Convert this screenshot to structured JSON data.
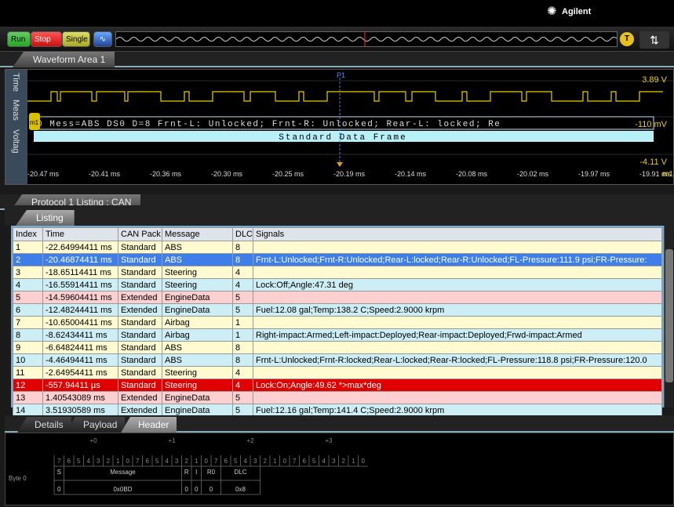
{
  "brand": {
    "name": "Agilent",
    "icon": "agilent-spark-icon"
  },
  "controls": {
    "run": "Run",
    "stop": "Stop",
    "single": "Single",
    "trigger": "T"
  },
  "waveform": {
    "tab": "Waveform Area 1",
    "side_labels": [
      "Time",
      "Meas",
      "Voltag"
    ],
    "ch_top": "3.89 V",
    "ch_mid": "-110 mV",
    "ch_bot": "-4.11 V",
    "marker": "P1",
    "ch_badge": "m1",
    "bottom_unit": "m1",
    "decode_line": "0  Mess=ABS  DS0  D=8  Frnt-L: Unlocked;  Frnt-R: Unlocked;  Rear-L: locked;  Re",
    "frame_label": "Standard Data Frame",
    "time_ticks": [
      "-20.47 ms",
      "-20.41 ms",
      "-20.36 ms",
      "-20.30 ms",
      "-20.25 ms",
      "-20.19 ms",
      "-20.14 ms",
      "-20.08 ms",
      "-20.02 ms",
      "-19.97 ms",
      "-19.91 ms"
    ]
  },
  "protocol": {
    "tab": "Protocol 1 Listing : CAN",
    "listing_tab": "Listing"
  },
  "listing": {
    "headers": [
      "Index",
      "Time",
      "CAN Pack",
      "Message",
      "DLC",
      "Signals"
    ],
    "rows": [
      [
        "1",
        "-22.64994411 ms",
        "Standard",
        "ABS",
        "8",
        ""
      ],
      [
        "2",
        "-20.46874411 ms",
        "Standard",
        "ABS",
        "8",
        "Frnt-L:Unlocked;Frnt-R:Unlocked;Rear-L:locked;Rear-R:Unlocked;FL-Pressure:111.9 psi;FR-Pressure:"
      ],
      [
        "3",
        "-18.65114411 ms",
        "Standard",
        "Steering",
        "4",
        ""
      ],
      [
        "4",
        "-16.55914411 ms",
        "Standard",
        "Steering",
        "4",
        "Lock:Off;Angle:47.31 deg"
      ],
      [
        "5",
        "-14.59604411 ms",
        "Extended",
        "EngineData",
        "5",
        ""
      ],
      [
        "6",
        "-12.48244411 ms",
        "Extended",
        "EngineData",
        "5",
        "Fuel:12.08 gal;Temp:138.2 C;Speed:2.9000 krpm"
      ],
      [
        "7",
        "-10.65004411 ms",
        "Standard",
        "Airbag",
        "1",
        ""
      ],
      [
        "8",
        "-8.62434411 ms",
        "Standard",
        "Airbag",
        "1",
        "Right-impact:Armed;Left-impact:Deployed;Rear-impact:Deployed;Frwd-impact:Armed"
      ],
      [
        "9",
        "-6.64824411 ms",
        "Standard",
        "ABS",
        "8",
        ""
      ],
      [
        "10",
        "-4.46494411 ms",
        "Standard",
        "ABS",
        "8",
        "Frnt-L:Unlocked;Frnt-R:locked;Rear-L:locked;Rear-R:locked;FL-Pressure:118.8 psi;FR-Pressure:120.0"
      ],
      [
        "11",
        "-2.64954411 ms",
        "Standard",
        "Steering",
        "4",
        ""
      ],
      [
        "12",
        "-557.94411 µs",
        "Standard",
        "Steering",
        "4",
        "Lock:On;Angle:49.62 *>max*deg"
      ],
      [
        "13",
        "1.40543089 ms",
        "Extended",
        "EngineData",
        "5",
        ""
      ],
      [
        "14",
        "3.51930589 ms",
        "Extended",
        "EngineData",
        "5",
        "Fuel:12.16 gal;Temp:141.4 C;Speed:2.9000 krpm"
      ]
    ],
    "row_classes": [
      "std",
      "selb",
      "std",
      "alt",
      "ext",
      "alt",
      "std",
      "alt",
      "std",
      "alt",
      "std",
      "selr",
      "ext",
      "alt"
    ]
  },
  "bottom": {
    "tabs": [
      "Details",
      "Payload",
      "Header"
    ],
    "byte_groups": [
      "+0",
      "+1",
      "+2",
      "+3"
    ],
    "bit_labels": [
      "7",
      "6",
      "5",
      "4",
      "3",
      "2",
      "1",
      "0",
      "7",
      "6",
      "5",
      "4",
      "3",
      "2",
      "1",
      "0",
      "7",
      "6",
      "5",
      "4",
      "3",
      "2",
      "1",
      "0",
      "7",
      "6",
      "5",
      "4",
      "3",
      "2",
      "1",
      "0"
    ],
    "row_label": "Byte 0",
    "fields": [
      {
        "name": "S",
        "value": "0"
      },
      {
        "name": "Message",
        "value": "0x0BD"
      },
      {
        "name": "R",
        "value": "0"
      },
      {
        "name": "I",
        "value": "0"
      },
      {
        "name": "R0",
        "value": "0"
      },
      {
        "name": "DLC",
        "value": "0x8"
      }
    ]
  }
}
